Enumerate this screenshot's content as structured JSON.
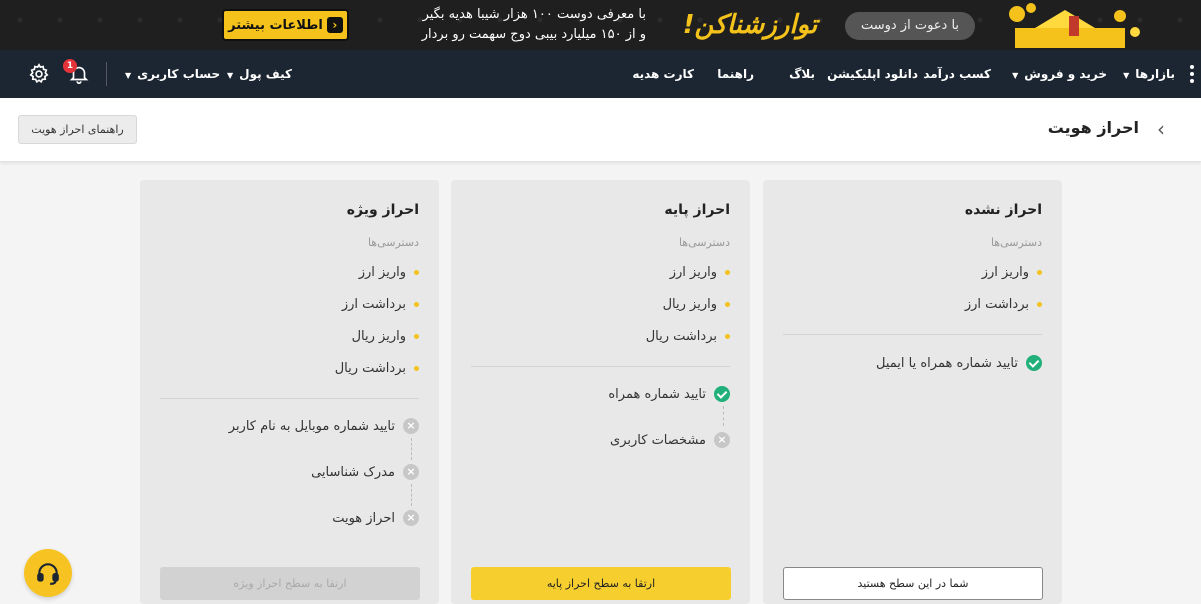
{
  "banner": {
    "more_info_label": "اطلاعات بیشتر",
    "text_line1": "با معرفی دوست ۱۰۰ هزار شیبا هدیه بگیر",
    "text_line2": "و از ۱۵۰ میلیارد بیبی دوج سهمت رو بردار",
    "logo_text": "توارزشناکن!",
    "invite_text": "با دعوت از دوست"
  },
  "navbar": {
    "items": [
      {
        "label": "بازارها"
      },
      {
        "label": "خرید و فروش"
      },
      {
        "label": "کسب درآمد"
      },
      {
        "label": "دانلود اپلیکیشن"
      },
      {
        "label": "بلاگ"
      },
      {
        "label": "راهنما"
      },
      {
        "label": "کارت هدیه"
      }
    ],
    "wallet_label": "کیف پول",
    "account_label": "حساب کاربری",
    "notification_count": "1"
  },
  "page": {
    "title": "احراز هویت",
    "guide_button": "راهنمای احراز هویت"
  },
  "cards": [
    {
      "title": "احراز نشده",
      "subtitle": "دسترسی‌ها",
      "access": [
        "واریز ارز",
        "برداشت ارز"
      ],
      "requirements": [
        {
          "label": "تایید شماره همراه یا ایمیل",
          "done": true
        }
      ],
      "button": "شما در این سطح هستید"
    },
    {
      "title": "احراز پایه",
      "subtitle": "دسترسی‌ها",
      "access": [
        "واریز ارز",
        "واریز ریال",
        "برداشت ریال"
      ],
      "requirements": [
        {
          "label": "تایید شماره همراه",
          "done": true
        },
        {
          "label": "مشخصات کاربری",
          "done": false
        }
      ],
      "button": "ارتقا به سطح احراز پایه"
    },
    {
      "title": "احراز ویژه",
      "subtitle": "دسترسی‌ها",
      "access": [
        "واریز ارز",
        "برداشت ارز",
        "واریز ریال",
        "برداشت ریال"
      ],
      "requirements": [
        {
          "label": "تایید شماره موبایل به نام کاربر",
          "done": false
        },
        {
          "label": "مدرک شناسایی",
          "done": false
        },
        {
          "label": "احراز هویت",
          "done": false
        }
      ],
      "button": "ارتقا به سطح احراز ویژه"
    }
  ],
  "colors": {
    "accent": "#f6cf2f",
    "navbar": "#1c2632",
    "success": "#21b07a"
  }
}
